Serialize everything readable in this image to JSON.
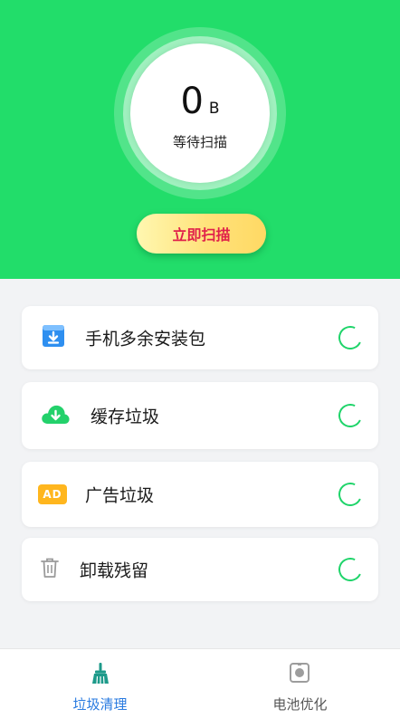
{
  "header": {
    "size_value": "0",
    "size_unit": "B",
    "status": "等待扫描",
    "scan_button": "立即扫描"
  },
  "items": [
    {
      "label": "手机多余安装包",
      "icon": "download-box-icon"
    },
    {
      "label": "缓存垃圾",
      "icon": "cloud-download-icon"
    },
    {
      "label": "广告垃圾",
      "icon": "ad-badge-icon",
      "badge_text": "AD"
    },
    {
      "label": "卸载残留",
      "icon": "trash-icon"
    }
  ],
  "tabs": [
    {
      "label": "垃圾清理",
      "icon": "broom-icon",
      "active": true
    },
    {
      "label": "电池优化",
      "icon": "battery-box-icon",
      "active": false
    }
  ],
  "colors": {
    "accent_green": "#22dd6a",
    "spinner_green": "#1fd46a",
    "button_text": "#e0204a",
    "tab_active": "#2a7be0",
    "tab_inactive": "#555555"
  }
}
